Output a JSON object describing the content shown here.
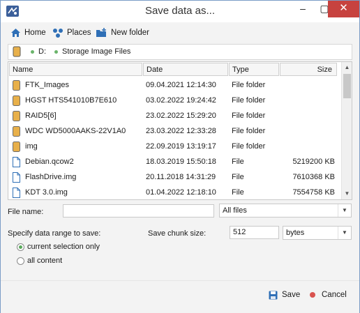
{
  "window": {
    "title": "Save data as...",
    "minimize_icon": "minimize-icon",
    "maximize_icon": "maximize-icon",
    "close_icon": "close-icon"
  },
  "toolbar": {
    "home_label": "Home",
    "places_label": "Places",
    "new_folder_label": "New folder"
  },
  "path": {
    "crumbs": [
      "D:",
      "Storage Image Files"
    ]
  },
  "columns": {
    "name": "Name",
    "date": "Date",
    "type": "Type",
    "size": "Size"
  },
  "files": [
    {
      "name": "FTK_Images",
      "date": "09.04.2021 12:14:30",
      "type": "File folder",
      "size": "",
      "icon": "folder-icon"
    },
    {
      "name": "HGST HTS541010B7E610",
      "date": "03.02.2022 19:24:42",
      "type": "File folder",
      "size": "",
      "icon": "folder-icon"
    },
    {
      "name": "RAID5[6]",
      "date": "23.02.2022 15:29:20",
      "type": "File folder",
      "size": "",
      "icon": "folder-icon"
    },
    {
      "name": "WDC WD5000AAKS-22V1A0",
      "date": "23.03.2022 12:33:28",
      "type": "File folder",
      "size": "",
      "icon": "folder-icon"
    },
    {
      "name": "img",
      "date": "22.09.2019 13:19:17",
      "type": "File folder",
      "size": "",
      "icon": "folder-icon"
    },
    {
      "name": "Debian.qcow2",
      "date": "18.03.2019 15:50:18",
      "type": "File",
      "size": "5219200 KB",
      "icon": "file-icon"
    },
    {
      "name": "FlashDrive.img",
      "date": "20.11.2018 14:31:29",
      "type": "File",
      "size": "7610368 KB",
      "icon": "file-icon"
    },
    {
      "name": "KDT 3.0.img",
      "date": "01.04.2022 12:18:10",
      "type": "File",
      "size": "7554758 KB",
      "icon": "file-icon"
    }
  ],
  "form": {
    "file_name_label": "File name:",
    "file_name_value": "",
    "filter_value": "All files",
    "range_label": "Specify data range to save:",
    "chunk_label": "Save chunk size:",
    "chunk_value": "512",
    "chunk_unit": "bytes",
    "radio_current": "current selection only",
    "radio_all": "all content",
    "selected_range": "current selection only"
  },
  "footer": {
    "save_label": "Save",
    "cancel_label": "Cancel"
  },
  "colors": {
    "accent": "#2b6cb0",
    "close_button": "#c7423f",
    "folder": "#e8b04a",
    "radio_on": "#58a85a",
    "cancel_dot": "#d9534f"
  }
}
